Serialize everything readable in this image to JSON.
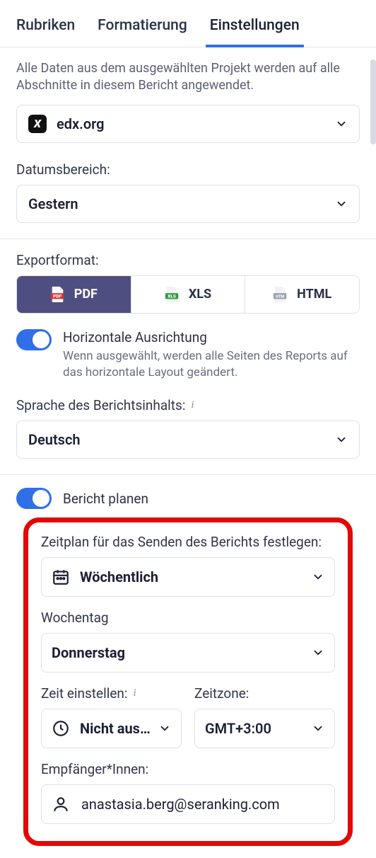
{
  "tabs": {
    "rubriken": "Rubriken",
    "formatierung": "Formatierung",
    "einstellungen": "Einstellungen"
  },
  "project": {
    "helper": "Alle Daten aus dem ausgewählten Projekt werden auf alle Abschnitte in diesem Bericht angewendet.",
    "value": "edx.org"
  },
  "date_range": {
    "label": "Datumsbereich:",
    "value": "Gestern"
  },
  "export": {
    "label": "Exportformat:",
    "pdf": "PDF",
    "xls": "XLS",
    "html": "HTML"
  },
  "orientation": {
    "title": "Horizontale Ausrichtung",
    "sub": "Wenn ausgewählt, werden alle Seiten des Reports auf das horizontale Layout geändert."
  },
  "language": {
    "label": "Sprache des Berichtsinhalts:",
    "value": "Deutsch"
  },
  "schedule_toggle": "Bericht planen",
  "schedule": {
    "set_label": "Zeitplan für das Senden des Berichts festlegen:",
    "freq": "Wöchentlich",
    "weekday_label": "Wochentag",
    "weekday": "Donnerstag",
    "time_label": "Zeit einstellen:",
    "time_value": "Nicht ausge…",
    "tz_label": "Zeitzone:",
    "tz_value": "GMT+3:00",
    "recipients_label": "Empfänger*Innen:",
    "recipients_value": "anastasia.berg@seranking.com"
  }
}
